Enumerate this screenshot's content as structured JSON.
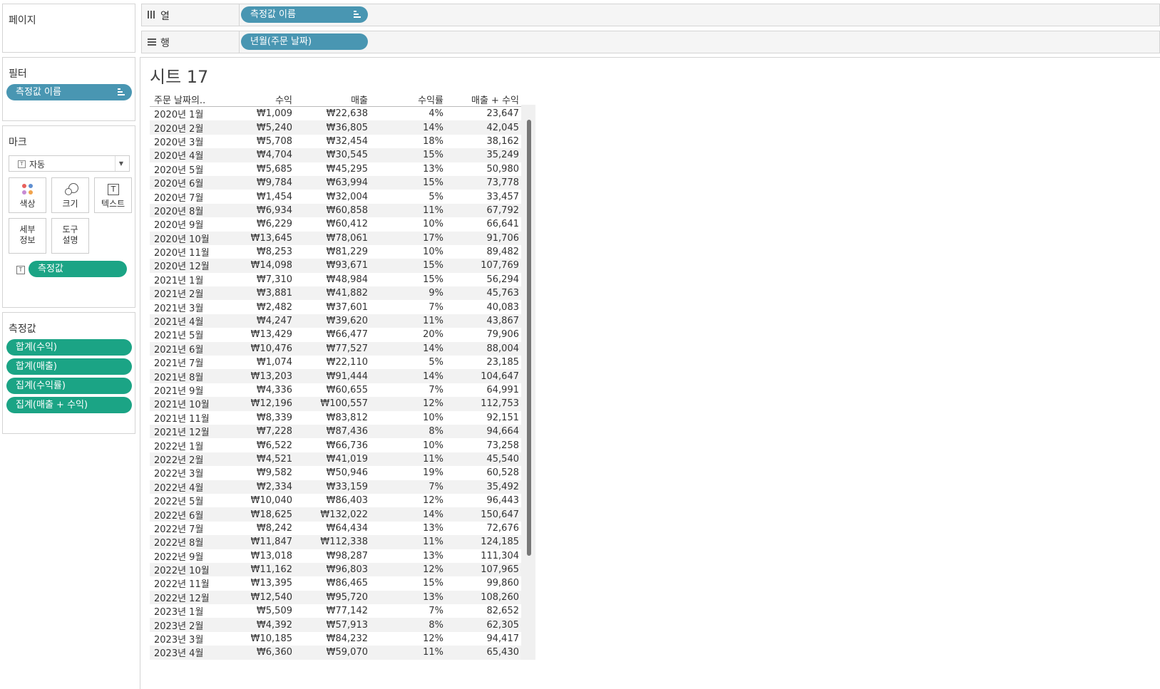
{
  "left": {
    "pages_title": "페이지",
    "filters_title": "필터",
    "filter_pill": "측정값 이름",
    "marks_title": "마크",
    "mark_type": "자동",
    "mark_cards": {
      "color": "색상",
      "size": "크기",
      "text": "텍스트",
      "detail_1": "세부",
      "detail_2": "정보",
      "tooltip_1": "도구",
      "tooltip_2": "설명"
    },
    "mark_text_pill": "측정값",
    "measures_title": "측정값",
    "measures": [
      "합계(수익)",
      "합계(매출)",
      "집계(수익률)",
      "집계(매출 + 수익)"
    ]
  },
  "shelves": {
    "columns_label": "열",
    "columns_pill": "측정값 이름",
    "rows_label": "행",
    "rows_pill": "년월(주문 날짜)"
  },
  "sheet_title": "시트 17",
  "table": {
    "headers": [
      "주문 날짜의..",
      "수익",
      "매출",
      "수익률",
      "매출 + 수익"
    ],
    "rows": [
      [
        "2020년 1월",
        "₩1,009",
        "₩22,638",
        "4%",
        "23,647"
      ],
      [
        "2020년 2월",
        "₩5,240",
        "₩36,805",
        "14%",
        "42,045"
      ],
      [
        "2020년 3월",
        "₩5,708",
        "₩32,454",
        "18%",
        "38,162"
      ],
      [
        "2020년 4월",
        "₩4,704",
        "₩30,545",
        "15%",
        "35,249"
      ],
      [
        "2020년 5월",
        "₩5,685",
        "₩45,295",
        "13%",
        "50,980"
      ],
      [
        "2020년 6월",
        "₩9,784",
        "₩63,994",
        "15%",
        "73,778"
      ],
      [
        "2020년 7월",
        "₩1,454",
        "₩32,004",
        "5%",
        "33,457"
      ],
      [
        "2020년 8월",
        "₩6,934",
        "₩60,858",
        "11%",
        "67,792"
      ],
      [
        "2020년 9월",
        "₩6,229",
        "₩60,412",
        "10%",
        "66,641"
      ],
      [
        "2020년 10월",
        "₩13,645",
        "₩78,061",
        "17%",
        "91,706"
      ],
      [
        "2020년 11월",
        "₩8,253",
        "₩81,229",
        "10%",
        "89,482"
      ],
      [
        "2020년 12월",
        "₩14,098",
        "₩93,671",
        "15%",
        "107,769"
      ],
      [
        "2021년 1월",
        "₩7,310",
        "₩48,984",
        "15%",
        "56,294"
      ],
      [
        "2021년 2월",
        "₩3,881",
        "₩41,882",
        "9%",
        "45,763"
      ],
      [
        "2021년 3월",
        "₩2,482",
        "₩37,601",
        "7%",
        "40,083"
      ],
      [
        "2021년 4월",
        "₩4,247",
        "₩39,620",
        "11%",
        "43,867"
      ],
      [
        "2021년 5월",
        "₩13,429",
        "₩66,477",
        "20%",
        "79,906"
      ],
      [
        "2021년 6월",
        "₩10,476",
        "₩77,527",
        "14%",
        "88,004"
      ],
      [
        "2021년 7월",
        "₩1,074",
        "₩22,110",
        "5%",
        "23,185"
      ],
      [
        "2021년 8월",
        "₩13,203",
        "₩91,444",
        "14%",
        "104,647"
      ],
      [
        "2021년 9월",
        "₩4,336",
        "₩60,655",
        "7%",
        "64,991"
      ],
      [
        "2021년 10월",
        "₩12,196",
        "₩100,557",
        "12%",
        "112,753"
      ],
      [
        "2021년 11월",
        "₩8,339",
        "₩83,812",
        "10%",
        "92,151"
      ],
      [
        "2021년 12월",
        "₩7,228",
        "₩87,436",
        "8%",
        "94,664"
      ],
      [
        "2022년 1월",
        "₩6,522",
        "₩66,736",
        "10%",
        "73,258"
      ],
      [
        "2022년 2월",
        "₩4,521",
        "₩41,019",
        "11%",
        "45,540"
      ],
      [
        "2022년 3월",
        "₩9,582",
        "₩50,946",
        "19%",
        "60,528"
      ],
      [
        "2022년 4월",
        "₩2,334",
        "₩33,159",
        "7%",
        "35,492"
      ],
      [
        "2022년 5월",
        "₩10,040",
        "₩86,403",
        "12%",
        "96,443"
      ],
      [
        "2022년 6월",
        "₩18,625",
        "₩132,022",
        "14%",
        "150,647"
      ],
      [
        "2022년 7월",
        "₩8,242",
        "₩64,434",
        "13%",
        "72,676"
      ],
      [
        "2022년 8월",
        "₩11,847",
        "₩112,338",
        "11%",
        "124,185"
      ],
      [
        "2022년 9월",
        "₩13,018",
        "₩98,287",
        "13%",
        "111,304"
      ],
      [
        "2022년 10월",
        "₩11,162",
        "₩96,803",
        "12%",
        "107,965"
      ],
      [
        "2022년 11월",
        "₩13,395",
        "₩86,465",
        "15%",
        "99,860"
      ],
      [
        "2022년 12월",
        "₩12,540",
        "₩95,720",
        "13%",
        "108,260"
      ],
      [
        "2023년 1월",
        "₩5,509",
        "₩77,142",
        "7%",
        "82,652"
      ],
      [
        "2023년 2월",
        "₩4,392",
        "₩57,913",
        "8%",
        "62,305"
      ],
      [
        "2023년 3월",
        "₩10,185",
        "₩84,232",
        "12%",
        "94,417"
      ],
      [
        "2023년 4월",
        "₩6,360",
        "₩59,070",
        "11%",
        "65,430"
      ]
    ]
  }
}
